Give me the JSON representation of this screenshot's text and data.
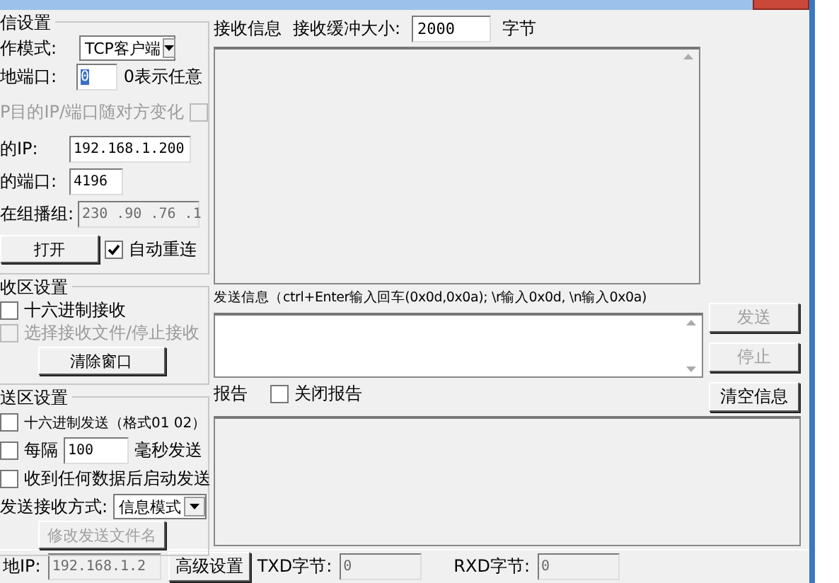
{
  "comm_settings": {
    "legend": "信设置",
    "mode": {
      "label": "作模式:",
      "value": "TCP客户端"
    },
    "local_port": {
      "label": "地端口:",
      "value": "0",
      "hint": "0表示任意"
    },
    "udp_follow": {
      "label": "P目的IP/端口随对方变化",
      "checked": false,
      "disabled": true
    },
    "dest_ip": {
      "label": "的IP:",
      "value": "192.168.1.200"
    },
    "dest_port": {
      "label": "的端口:",
      "value": "4196"
    },
    "multicast": {
      "label": "在组播组:",
      "value": "230 .90 .76 .1",
      "disabled": true
    },
    "open_button": "打开",
    "auto_reconnect": {
      "label": "自动重连",
      "checked": true
    }
  },
  "receive_settings": {
    "legend": "收区设置",
    "options": [
      {
        "label": "十六进制接收",
        "checked": false,
        "disabled": false
      },
      {
        "label": "选择接收文件/停止接收",
        "checked": false,
        "disabled": true
      }
    ],
    "clear_button": "清除窗口"
  },
  "send_settings": {
    "legend": "送区设置",
    "hex_send": {
      "label": "十六进制发送（格式01 02）",
      "checked": false
    },
    "interval": {
      "label": "每隔",
      "checked": false,
      "value": "100",
      "unit": "毫秒发送"
    },
    "auto_send": {
      "label": "收到任何数据后启动发送",
      "checked": false
    },
    "mode": {
      "label": "发送接收方式:",
      "value": "信息模式"
    },
    "rename_button": {
      "label": "修改发送文件名",
      "disabled": true
    }
  },
  "receive": {
    "label": "接收信息",
    "buffer_label": "接收缓冲大小:",
    "buffer_value": "2000",
    "unit": "字节"
  },
  "send": {
    "label": "发送信息（ctrl+Enter输入回车(0x0d,0x0a); \\r输入0x0d, \\n输入0x0a)"
  },
  "buttons": [
    {
      "label": "发送",
      "disabled": true
    },
    {
      "label": "停止",
      "disabled": true
    },
    {
      "label": "清空信息",
      "disabled": false
    }
  ],
  "report": {
    "label": "报告",
    "close_report": {
      "label": "关闭报告",
      "checked": false
    }
  },
  "status_bar": {
    "local_ip": {
      "label": "地IP:",
      "value": "192.168.1.2"
    },
    "advanced_button": "高级设置",
    "txd": {
      "label": "TXD字节:",
      "value": "0"
    },
    "rxd": {
      "label": "RXD字节:",
      "value": "0"
    }
  }
}
